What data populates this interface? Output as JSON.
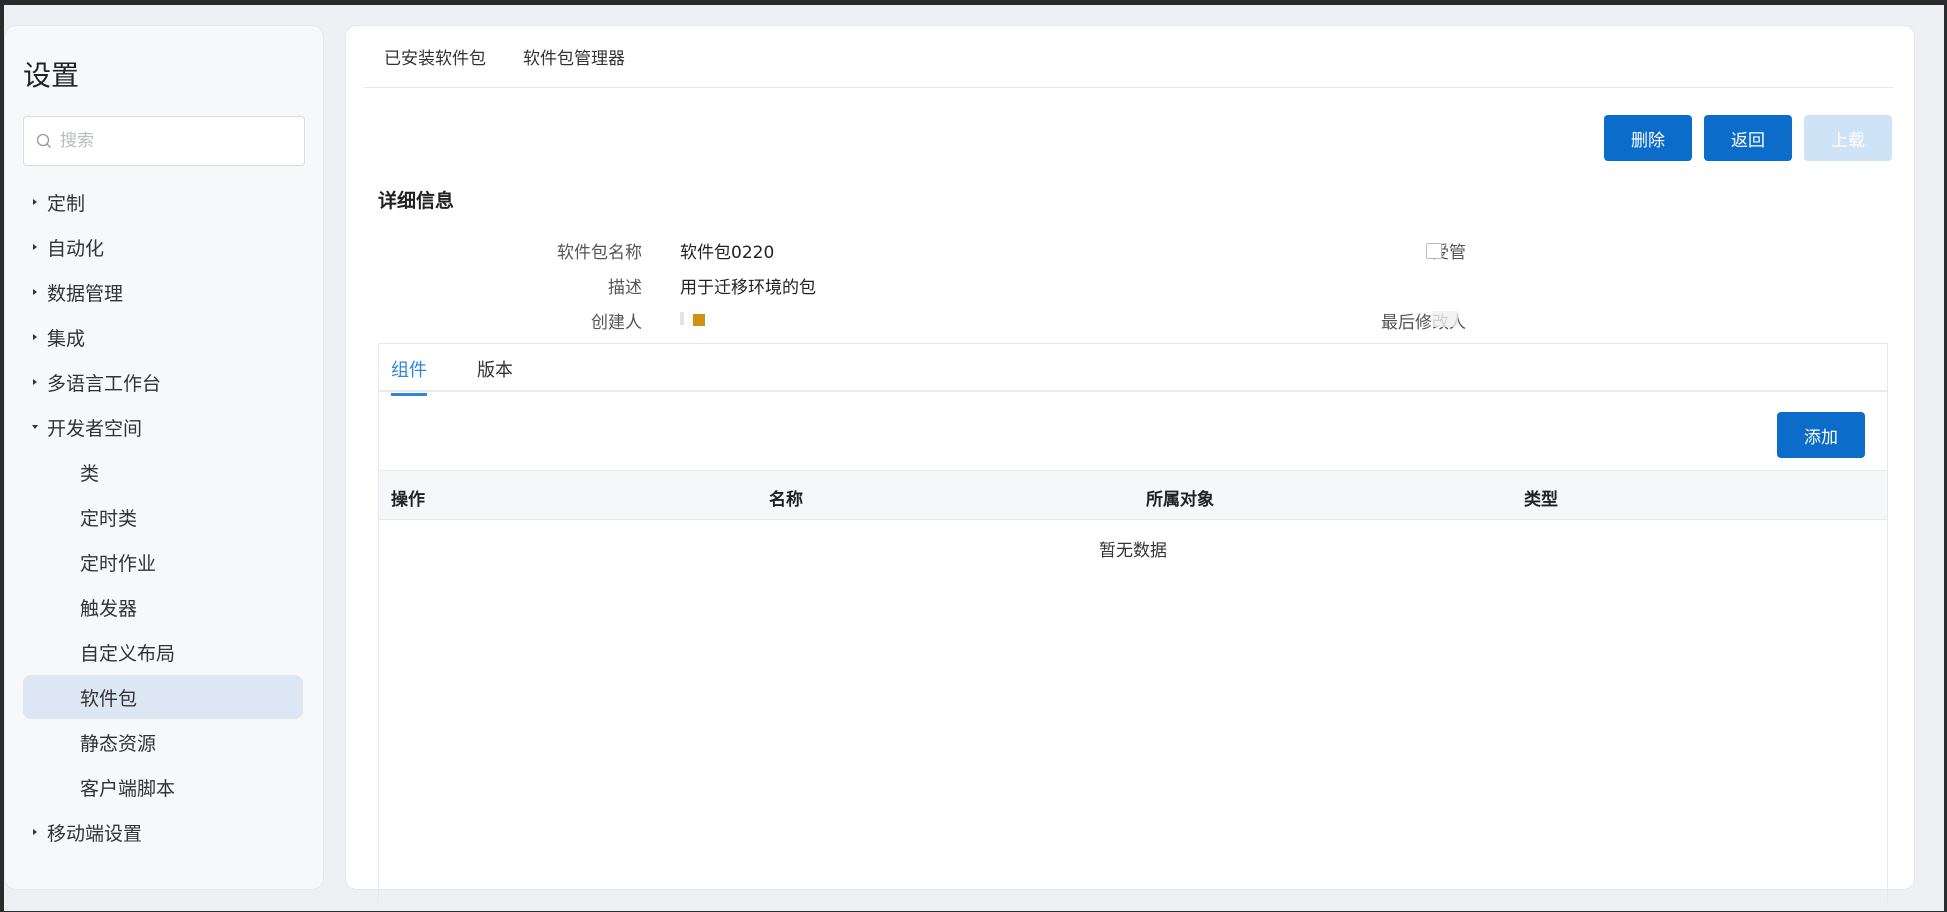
{
  "sidebar": {
    "title": "设置",
    "search_placeholder": "搜索",
    "items": [
      {
        "label": "定制"
      },
      {
        "label": "自动化"
      },
      {
        "label": "数据管理"
      },
      {
        "label": "集成"
      },
      {
        "label": "多语言工作台"
      },
      {
        "label": "开发者空间"
      },
      {
        "label": "类"
      },
      {
        "label": "定时类"
      },
      {
        "label": "定时作业"
      },
      {
        "label": "触发器"
      },
      {
        "label": "自定义布局"
      },
      {
        "label": "软件包"
      },
      {
        "label": "静态资源"
      },
      {
        "label": "客户端脚本"
      },
      {
        "label": "移动端设置"
      }
    ]
  },
  "top_tabs": [
    "已安装软件包",
    "软件包管理器"
  ],
  "actions": {
    "delete_label": "删除",
    "back_label": "返回",
    "upload_label": "上载"
  },
  "detail": {
    "section_title": "详细信息",
    "name_label": "软件包名称",
    "name_value": "软件包0220",
    "desc_label": "描述",
    "desc_value": "用于迁移环境的包",
    "creator_label": "创建人",
    "managed_label": "受管",
    "modifier_label": "最后修改人"
  },
  "panel": {
    "tabs": [
      "组件",
      "版本"
    ],
    "add_label": "添加",
    "columns": [
      "操作",
      "名称",
      "所属对象",
      "类型"
    ],
    "empty_text": "暂无数据"
  },
  "colors": {
    "primary": "#0b6cc9",
    "disabled": "#cfe3f7",
    "active_tab": "#2d88d8",
    "active_nav": "#dde6f3",
    "avatar": "#d4900f"
  }
}
